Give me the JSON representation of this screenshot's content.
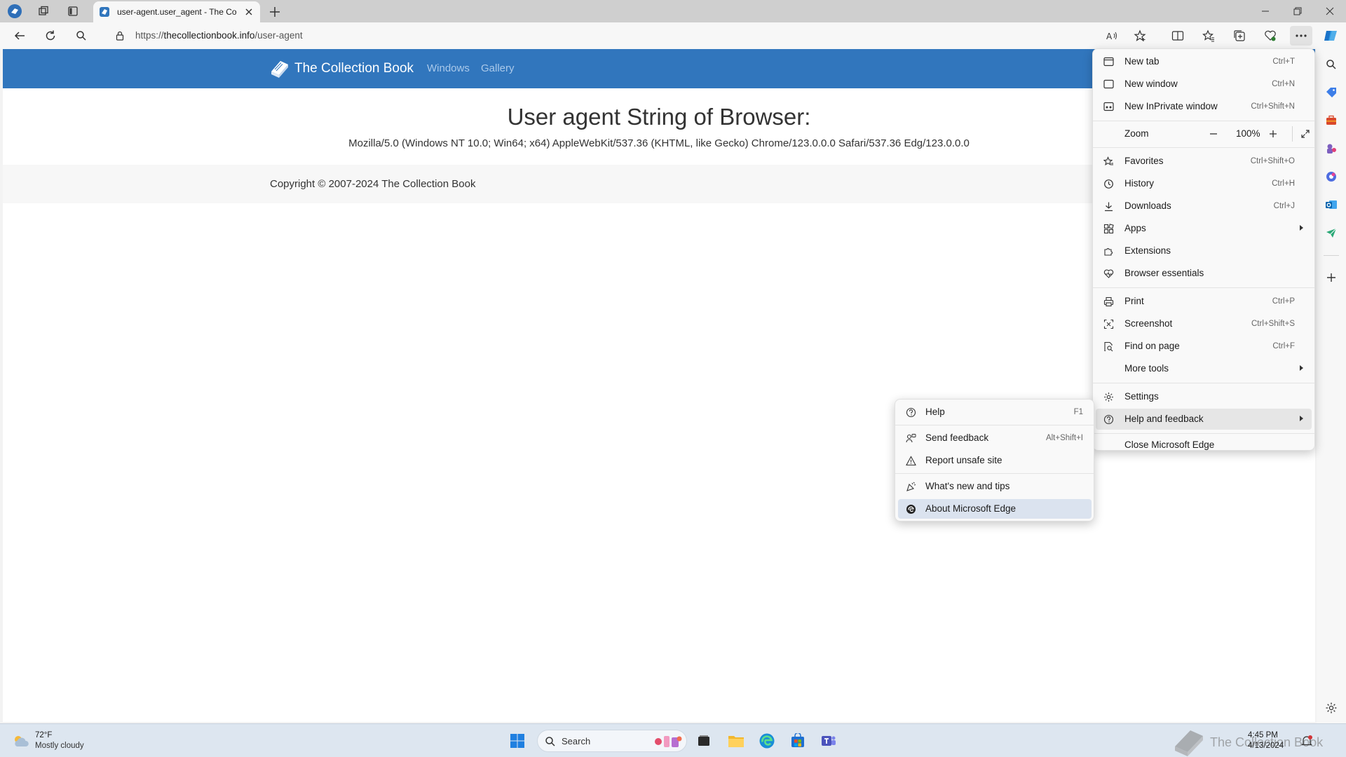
{
  "tab": {
    "title": "user-agent.user_agent - The Collection Book"
  },
  "address": {
    "url_prefix": "https://",
    "url_host": "thecollectionbook.info",
    "url_path": "/user-agent"
  },
  "site": {
    "brand": "The Collection Book",
    "nav": [
      "Windows",
      "Gallery"
    ],
    "heading": "User agent String of Browser:",
    "user_agent": "Mozilla/5.0 (Windows NT 10.0; Win64; x64) AppleWebKit/537.36 (KHTML, like Gecko) Chrome/123.0.0.0 Safari/537.36 Edg/123.0.0.0",
    "copyright": "Copyright © 2007-2024 The Collection Book"
  },
  "menu": {
    "new_tab": {
      "label": "New tab",
      "shortcut": "Ctrl+T"
    },
    "new_window": {
      "label": "New window",
      "shortcut": "Ctrl+N"
    },
    "new_inprivate": {
      "label": "New InPrivate window",
      "shortcut": "Ctrl+Shift+N"
    },
    "zoom": {
      "label": "Zoom",
      "value": "100%"
    },
    "favorites": {
      "label": "Favorites",
      "shortcut": "Ctrl+Shift+O"
    },
    "history": {
      "label": "History",
      "shortcut": "Ctrl+H"
    },
    "downloads": {
      "label": "Downloads",
      "shortcut": "Ctrl+J"
    },
    "apps": {
      "label": "Apps"
    },
    "extensions": {
      "label": "Extensions"
    },
    "browser_essentials": {
      "label": "Browser essentials"
    },
    "print": {
      "label": "Print",
      "shortcut": "Ctrl+P"
    },
    "screenshot": {
      "label": "Screenshot",
      "shortcut": "Ctrl+Shift+S"
    },
    "find": {
      "label": "Find on page",
      "shortcut": "Ctrl+F"
    },
    "more_tools": {
      "label": "More tools"
    },
    "settings": {
      "label": "Settings"
    },
    "help_feedback": {
      "label": "Help and feedback"
    },
    "close_edge": {
      "label": "Close Microsoft Edge"
    }
  },
  "submenu": {
    "help": {
      "label": "Help",
      "shortcut": "F1"
    },
    "send_feedback": {
      "label": "Send feedback",
      "shortcut": "Alt+Shift+I"
    },
    "report_unsafe": {
      "label": "Report unsafe site"
    },
    "whats_new": {
      "label": "What's new and tips"
    },
    "about": {
      "label": "About Microsoft Edge"
    }
  },
  "taskbar": {
    "weather_temp": "72°F",
    "weather_desc": "Mostly cloudy",
    "search_placeholder": "Search",
    "time": "4:45 PM",
    "date": "4/13/2024",
    "watermark": "The Collection Book"
  },
  "colors": {
    "accent": "#3176bd",
    "edge_blue": "#1a73c9"
  }
}
